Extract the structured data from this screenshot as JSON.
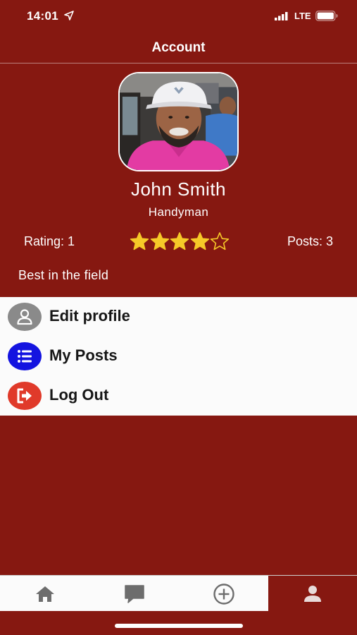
{
  "status_bar": {
    "time": "14:01",
    "network": "LTE"
  },
  "nav": {
    "title": "Account"
  },
  "profile": {
    "name": "John Smith",
    "role": "Handyman",
    "rating_label": "Rating: 1",
    "star_rating": 4,
    "star_max": 5,
    "posts_label": "Posts: 3",
    "bio": "Best in the field"
  },
  "menu": {
    "items": [
      {
        "label": "Edit profile",
        "icon": "user-icon",
        "icon_color": "#8a8a8a"
      },
      {
        "label": "My Posts",
        "icon": "list-icon",
        "icon_color": "#1414e0"
      },
      {
        "label": "Log Out",
        "icon": "logout-icon",
        "icon_color": "#e03a2a"
      }
    ]
  },
  "tab_bar": {
    "tabs": [
      {
        "icon": "home-icon",
        "active": false
      },
      {
        "icon": "chat-icon",
        "active": false
      },
      {
        "icon": "add-circle-icon",
        "active": false
      },
      {
        "icon": "profile-icon",
        "active": true
      }
    ]
  },
  "colors": {
    "background": "#861811",
    "star": "#f6c928",
    "menu_background": "#fbfbfb",
    "tab_icon": "#6d6d6d"
  }
}
